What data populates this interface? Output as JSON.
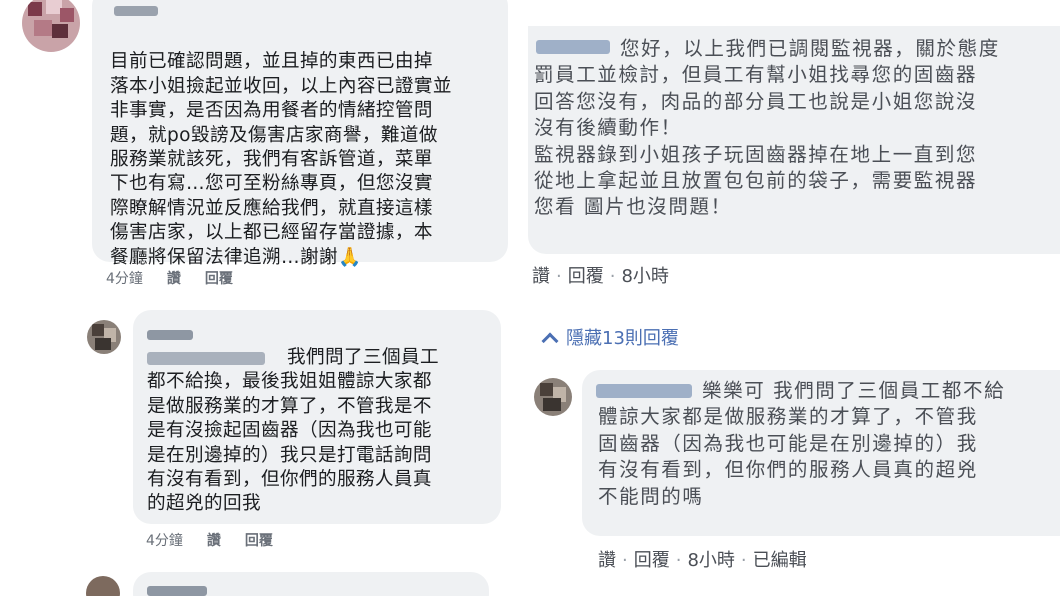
{
  "left": {
    "comment1": {
      "text": "目前已確認問題，並且掉的東西已由掉\n落本小姐撿起並收回，以上內容已證實並\n非事實，是否因為用餐者的情緒控管問\n題，就po毀謗及傷害店家商譽，難道做\n服務業就該死，我們有客訴管道，菜單\n下也有寫…您可至粉絲專頁，但您沒實\n際瞭解情況並反應給我們，就直接這樣\n傷害店家，以上都已經留存當證據，本\n餐廳將保留法律追溯…謝謝",
      "emoji": "🙏",
      "time": "4分鐘",
      "like": "讚",
      "reply": "回覆"
    },
    "comment2": {
      "text": "我們問了三個員工\n都不給換，最後我姐姐體諒大家都\n是做服務業的才算了，不管我是不\n是有沒撿起固齒器（因為我也可能\n是在別邊掉的）我只是打電話詢問\n有沒有看到，但你們的服務人員真\n的超兇的回我",
      "time": "4分鐘",
      "like": "讚",
      "reply": "回覆"
    }
  },
  "right": {
    "comment1": {
      "text": "您好，以上我們已調閱監視器，關於態度\n罰員工並檢討，但員工有幫小姐找尋您的固齒器\n回答您沒有，肉品的部分員工也說是小姐您說沒\n沒有後續動作！\n監視器錄到小姐孩子玩固齒器掉在地上一直到您\n從地上拿起並且放置包包前的袋子，需要監視器\n您看 圖片也沒問題！",
      "like": "讚",
      "reply": "回覆",
      "time": "8小時"
    },
    "hidden_replies": "隱藏13則回覆",
    "comment2": {
      "text": "樂樂可 我們問了三個員工都不給\n體諒大家都是做服務業的才算了，不管我\n固齒器（因為我也可能是在別邊掉的）我\n有沒有看到，但你們的服務人員真的超兇\n不能問的嗎",
      "like": "讚",
      "reply": "回覆",
      "time": "8小時",
      "edited": "已編輯"
    }
  },
  "colors": {
    "bubble": "#eff1f3",
    "meta": "#6a7079",
    "link": "#4b6fb3"
  }
}
